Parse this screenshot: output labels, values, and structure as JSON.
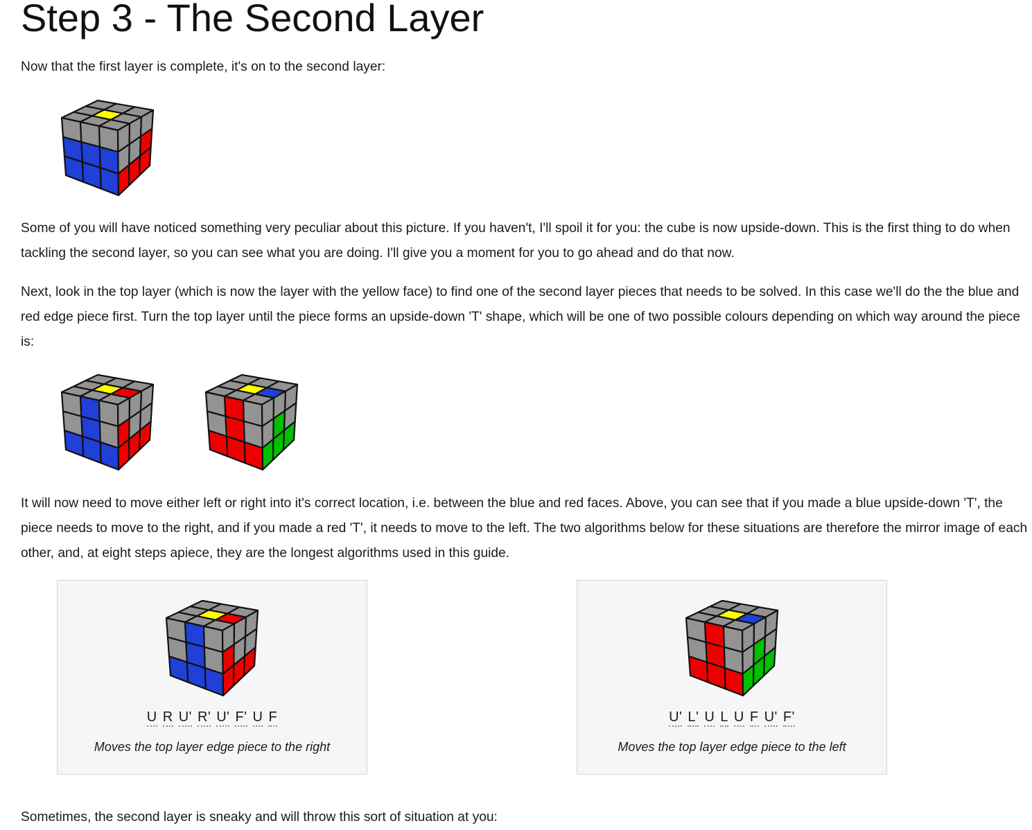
{
  "heading": "Step 3 - The Second Layer",
  "paragraphs": {
    "intro": "Now that the first layer is complete, it's on to the second layer:",
    "upside_down": "Some of you will have noticed something very peculiar about this picture. If you haven't, I'll spoil it for you: the cube is now upside-down. This is the first thing to do when tackling the second layer, so you can see what you are doing. I'll give you a moment for you to go ahead and do that now.",
    "find_piece": "Next, look in the top layer (which is now the layer with the yellow face) to find one of the second layer pieces that needs to be solved. In this case we'll do the the blue and red edge piece first. Turn the top layer until the piece forms an upside-down 'T' shape, which will be one of two possible colours depending on which way around the piece is:",
    "move_piece": "It will now need to move either left or right into it's correct location, i.e. between the blue and red faces. Above, you can see that if you made a blue upside-down 'T', the piece needs to move to the right, and if you made a red 'T', it needs to move to the left. The two algorithms below for these situations are therefore the mirror image of each other, and, at eight steps apiece, they are the longest algorithms used in this guide.",
    "sneaky": "Sometimes, the second layer is sneaky and will throw this sort of situation at you:"
  },
  "colors": {
    "grey": "#939393",
    "yellow": "#fefe00",
    "blue": "#2040d8",
    "red": "#ee0000",
    "green": "#00c000",
    "sticker_border": "#111111",
    "box_background": "#f6f6f6",
    "box_border": "#d4d4d4"
  },
  "cubes": {
    "first_layer_done": {
      "top": [
        "grey",
        "grey",
        "grey",
        "grey",
        "yellow",
        "grey",
        "grey",
        "grey",
        "grey"
      ],
      "front": [
        "grey",
        "grey",
        "grey",
        "blue",
        "blue",
        "blue",
        "blue",
        "blue",
        "blue"
      ],
      "right": [
        "grey",
        "grey",
        "grey",
        "grey",
        "grey",
        "red",
        "red",
        "red",
        "red"
      ]
    },
    "blue_t": {
      "top": [
        "grey",
        "grey",
        "grey",
        "grey",
        "yellow",
        "grey",
        "grey",
        "red",
        "grey"
      ],
      "front": [
        "grey",
        "blue",
        "grey",
        "grey",
        "blue",
        "grey",
        "blue",
        "blue",
        "blue"
      ],
      "right": [
        "grey",
        "grey",
        "grey",
        "red",
        "grey",
        "grey",
        "red",
        "red",
        "red"
      ]
    },
    "red_t": {
      "top": [
        "grey",
        "grey",
        "grey",
        "grey",
        "yellow",
        "grey",
        "grey",
        "blue",
        "grey"
      ],
      "front": [
        "grey",
        "red",
        "grey",
        "grey",
        "red",
        "grey",
        "red",
        "red",
        "red"
      ],
      "right": [
        "grey",
        "grey",
        "grey",
        "grey",
        "green",
        "grey",
        "green",
        "green",
        "green"
      ]
    }
  },
  "algorithms": [
    {
      "moves": [
        "U",
        "R",
        "U'",
        "R'",
        "U'",
        "F'",
        "U",
        "F"
      ],
      "caption": "Moves the top layer edge piece to the right",
      "cube": "blue_t"
    },
    {
      "moves": [
        "U'",
        "L'",
        "U",
        "L",
        "U",
        "F",
        "U'",
        "F'"
      ],
      "caption": "Moves the top layer edge piece to the left",
      "cube": "red_t"
    }
  ]
}
